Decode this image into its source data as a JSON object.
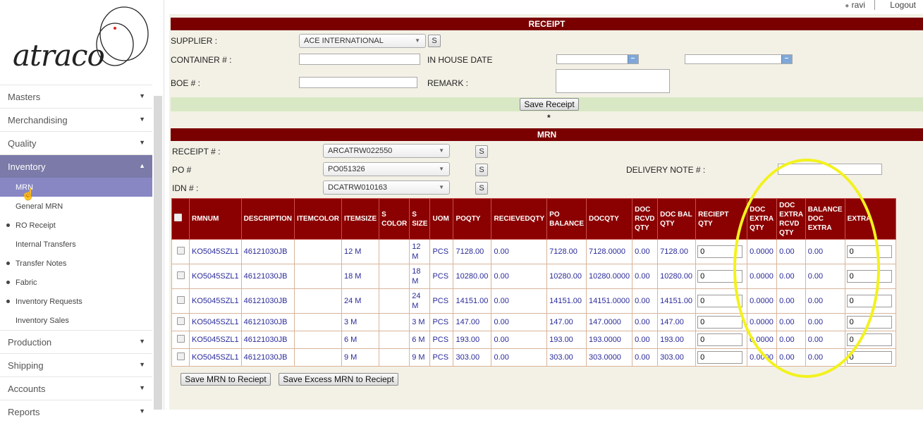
{
  "user": {
    "name": "ravi",
    "logout": "Logout"
  },
  "logo": {
    "text": "atraco"
  },
  "nav": {
    "masters": "Masters",
    "merchandising": "Merchandising",
    "quality": "Quality",
    "inventory": "Inventory",
    "sub": [
      "MRN",
      "General MRN",
      "RO Receipt",
      "Internal Transfers",
      "Transfer Notes",
      "Fabric",
      "Inventory Requests",
      "Inventory Sales"
    ],
    "production": "Production",
    "shipping": "Shipping",
    "accounts": "Accounts",
    "reports": "Reports"
  },
  "receipt": {
    "title": "RECEIPT",
    "supplier_label": "SUPPLIER :",
    "supplier_value": "ACE INTERNATIONAL",
    "s_button": "S",
    "container_label": "CONTAINER # :",
    "in_house_label": "IN HOUSE DATE",
    "boe_label": "BOE # :",
    "remark_label": "REMARK :",
    "save_button": "Save Receipt",
    "asterisk": "*"
  },
  "mrn": {
    "title": "MRN",
    "receipt_label": "RECEIPT # :",
    "receipt_value": "ARCATRW022550",
    "po_label": "PO #",
    "po_value": "PO051326",
    "idn_label": "IDN # :",
    "idn_value": "DCATRW010163",
    "delivery_label": "DELIVERY NOTE # :",
    "s_button": "S"
  },
  "table": {
    "headers": [
      "RMNUM",
      "DESCRIPTION",
      "ITEMCOLOR",
      "ITEMSIZE",
      "S COLOR",
      "S SIZE",
      "UOM",
      "POQTY",
      "RECIEVEDQTY",
      "PO BALANCE",
      "DOCQTY",
      "DOC RCVD QTY",
      "DOC BAL QTY",
      "RECIEPT QTY",
      "DOC EXTRA QTY",
      "DOC EXTRA RCVD QTY",
      "BALANCE DOC EXTRA",
      "EXTRA"
    ],
    "rows": [
      [
        "KO5045SZL1",
        "46121030JB",
        "",
        "12 M",
        "",
        "12 M",
        "PCS",
        "7128.00",
        "0.00",
        "7128.00",
        "7128.0000",
        "0.00",
        "7128.00",
        "0",
        "0.0000",
        "0.00",
        "0.00",
        "0"
      ],
      [
        "KO5045SZL1",
        "46121030JB",
        "",
        "18 M",
        "",
        "18 M",
        "PCS",
        "10280.00",
        "0.00",
        "10280.00",
        "10280.0000",
        "0.00",
        "10280.00",
        "0",
        "0.0000",
        "0.00",
        "0.00",
        "0"
      ],
      [
        "KO5045SZL1",
        "46121030JB",
        "",
        "24 M",
        "",
        "24 M",
        "PCS",
        "14151.00",
        "0.00",
        "14151.00",
        "14151.0000",
        "0.00",
        "14151.00",
        "0",
        "0.0000",
        "0.00",
        "0.00",
        "0"
      ],
      [
        "KO5045SZL1",
        "46121030JB",
        "",
        "3 M",
        "",
        "3 M",
        "PCS",
        "147.00",
        "0.00",
        "147.00",
        "147.0000",
        "0.00",
        "147.00",
        "0",
        "0.0000",
        "0.00",
        "0.00",
        "0"
      ],
      [
        "KO5045SZL1",
        "46121030JB",
        "",
        "6 M",
        "",
        "6 M",
        "PCS",
        "193.00",
        "0.00",
        "193.00",
        "193.0000",
        "0.00",
        "193.00",
        "0",
        "0.0000",
        "0.00",
        "0.00",
        "0"
      ],
      [
        "KO5045SZL1",
        "46121030JB",
        "",
        "9 M",
        "",
        "9 M",
        "PCS",
        "303.00",
        "0.00",
        "303.00",
        "303.0000",
        "0.00",
        "303.00",
        "0",
        "0.0000",
        "0.00",
        "0.00",
        "0"
      ]
    ]
  },
  "buttons": {
    "save_mrn": "Save MRN to Reciept",
    "save_excess": "Save Excess MRN to Reciept"
  },
  "colors": {
    "band": "#7a0000",
    "header": "#8b0000",
    "nav_active": "#7b7aa8",
    "highlight": "#f2f21e"
  }
}
